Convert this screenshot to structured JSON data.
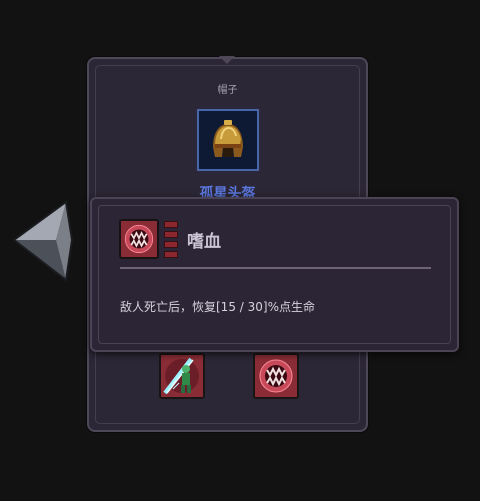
{
  "item_panel": {
    "slot_label": "帽子",
    "item_name": "孤星头盔",
    "item_icon": "helmet-icon",
    "small_slots": [
      {
        "icon": "green-warrior-slash-icon"
      },
      {
        "icon": "blood-maw-icon"
      }
    ]
  },
  "tooltip": {
    "skill_name": "嗜血",
    "skill_icon": "blood-maw-icon",
    "tier_count": 4,
    "description": "敌人死亡后，恢复[15 / 30]%点生命"
  },
  "colors": {
    "panel_bg": "#2c2736",
    "item_name": "#5a78e0",
    "skill_icon_red": "#7d2a34"
  }
}
